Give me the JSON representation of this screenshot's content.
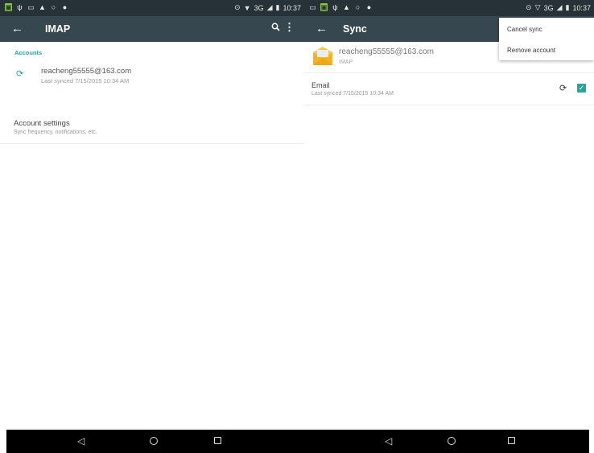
{
  "left": {
    "toolbar": {
      "back_icon": "arrow-left-icon",
      "title": "IMAP",
      "search_icon": "search-icon",
      "more_icon": "more-vert-icon"
    },
    "accounts_header": "Accounts",
    "account": {
      "email": "reacheng55555@163.com",
      "last_synced": "Last synced 7/15/2015 10:34 AM",
      "icon": "sync-icon"
    },
    "settings": {
      "title": "Account settings",
      "subtitle": "Sync frequency, notifications, etc."
    },
    "status": {
      "time": "10:37",
      "network": "3G"
    }
  },
  "right": {
    "toolbar": {
      "back_icon": "arrow-left-icon",
      "title": "Sync"
    },
    "account": {
      "email": "reacheng55555@163.com",
      "type": "IMAP",
      "icon": "envelope-icon"
    },
    "sync_item": {
      "label": "Email",
      "last_synced": "Last synced 7/15/2015 10:34 AM",
      "checked": true
    },
    "menu": {
      "items": [
        "Cancel sync",
        "Remove account"
      ]
    },
    "status": {
      "time": "10:37",
      "network": "3G"
    }
  },
  "colors": {
    "toolbar": "#37474f",
    "statusbar": "#263238",
    "accent": "#26a69a",
    "navbar": "#000000"
  }
}
